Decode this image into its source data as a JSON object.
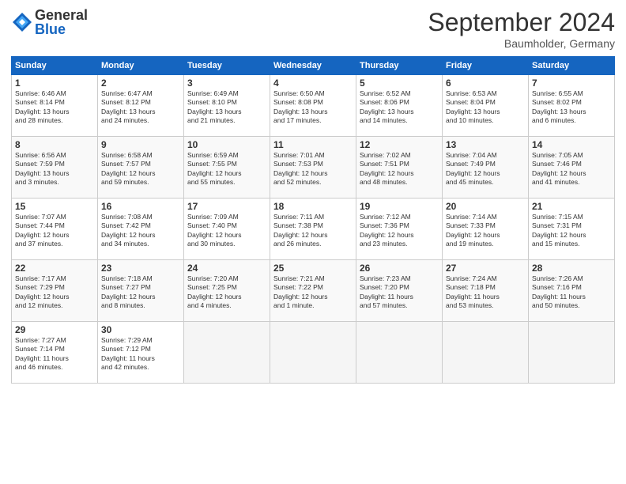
{
  "logo": {
    "general": "General",
    "blue": "Blue"
  },
  "title": "September 2024",
  "subtitle": "Baumholder, Germany",
  "headers": [
    "Sunday",
    "Monday",
    "Tuesday",
    "Wednesday",
    "Thursday",
    "Friday",
    "Saturday"
  ],
  "weeks": [
    [
      {
        "day": "1",
        "info": "Sunrise: 6:46 AM\nSunset: 8:14 PM\nDaylight: 13 hours\nand 28 minutes."
      },
      {
        "day": "2",
        "info": "Sunrise: 6:47 AM\nSunset: 8:12 PM\nDaylight: 13 hours\nand 24 minutes."
      },
      {
        "day": "3",
        "info": "Sunrise: 6:49 AM\nSunset: 8:10 PM\nDaylight: 13 hours\nand 21 minutes."
      },
      {
        "day": "4",
        "info": "Sunrise: 6:50 AM\nSunset: 8:08 PM\nDaylight: 13 hours\nand 17 minutes."
      },
      {
        "day": "5",
        "info": "Sunrise: 6:52 AM\nSunset: 8:06 PM\nDaylight: 13 hours\nand 14 minutes."
      },
      {
        "day": "6",
        "info": "Sunrise: 6:53 AM\nSunset: 8:04 PM\nDaylight: 13 hours\nand 10 minutes."
      },
      {
        "day": "7",
        "info": "Sunrise: 6:55 AM\nSunset: 8:02 PM\nDaylight: 13 hours\nand 6 minutes."
      }
    ],
    [
      {
        "day": "8",
        "info": "Sunrise: 6:56 AM\nSunset: 7:59 PM\nDaylight: 13 hours\nand 3 minutes."
      },
      {
        "day": "9",
        "info": "Sunrise: 6:58 AM\nSunset: 7:57 PM\nDaylight: 12 hours\nand 59 minutes."
      },
      {
        "day": "10",
        "info": "Sunrise: 6:59 AM\nSunset: 7:55 PM\nDaylight: 12 hours\nand 55 minutes."
      },
      {
        "day": "11",
        "info": "Sunrise: 7:01 AM\nSunset: 7:53 PM\nDaylight: 12 hours\nand 52 minutes."
      },
      {
        "day": "12",
        "info": "Sunrise: 7:02 AM\nSunset: 7:51 PM\nDaylight: 12 hours\nand 48 minutes."
      },
      {
        "day": "13",
        "info": "Sunrise: 7:04 AM\nSunset: 7:49 PM\nDaylight: 12 hours\nand 45 minutes."
      },
      {
        "day": "14",
        "info": "Sunrise: 7:05 AM\nSunset: 7:46 PM\nDaylight: 12 hours\nand 41 minutes."
      }
    ],
    [
      {
        "day": "15",
        "info": "Sunrise: 7:07 AM\nSunset: 7:44 PM\nDaylight: 12 hours\nand 37 minutes."
      },
      {
        "day": "16",
        "info": "Sunrise: 7:08 AM\nSunset: 7:42 PM\nDaylight: 12 hours\nand 34 minutes."
      },
      {
        "day": "17",
        "info": "Sunrise: 7:09 AM\nSunset: 7:40 PM\nDaylight: 12 hours\nand 30 minutes."
      },
      {
        "day": "18",
        "info": "Sunrise: 7:11 AM\nSunset: 7:38 PM\nDaylight: 12 hours\nand 26 minutes."
      },
      {
        "day": "19",
        "info": "Sunrise: 7:12 AM\nSunset: 7:36 PM\nDaylight: 12 hours\nand 23 minutes."
      },
      {
        "day": "20",
        "info": "Sunrise: 7:14 AM\nSunset: 7:33 PM\nDaylight: 12 hours\nand 19 minutes."
      },
      {
        "day": "21",
        "info": "Sunrise: 7:15 AM\nSunset: 7:31 PM\nDaylight: 12 hours\nand 15 minutes."
      }
    ],
    [
      {
        "day": "22",
        "info": "Sunrise: 7:17 AM\nSunset: 7:29 PM\nDaylight: 12 hours\nand 12 minutes."
      },
      {
        "day": "23",
        "info": "Sunrise: 7:18 AM\nSunset: 7:27 PM\nDaylight: 12 hours\nand 8 minutes."
      },
      {
        "day": "24",
        "info": "Sunrise: 7:20 AM\nSunset: 7:25 PM\nDaylight: 12 hours\nand 4 minutes."
      },
      {
        "day": "25",
        "info": "Sunrise: 7:21 AM\nSunset: 7:22 PM\nDaylight: 12 hours\nand 1 minute."
      },
      {
        "day": "26",
        "info": "Sunrise: 7:23 AM\nSunset: 7:20 PM\nDaylight: 11 hours\nand 57 minutes."
      },
      {
        "day": "27",
        "info": "Sunrise: 7:24 AM\nSunset: 7:18 PM\nDaylight: 11 hours\nand 53 minutes."
      },
      {
        "day": "28",
        "info": "Sunrise: 7:26 AM\nSunset: 7:16 PM\nDaylight: 11 hours\nand 50 minutes."
      }
    ],
    [
      {
        "day": "29",
        "info": "Sunrise: 7:27 AM\nSunset: 7:14 PM\nDaylight: 11 hours\nand 46 minutes."
      },
      {
        "day": "30",
        "info": "Sunrise: 7:29 AM\nSunset: 7:12 PM\nDaylight: 11 hours\nand 42 minutes."
      },
      {
        "day": "",
        "info": ""
      },
      {
        "day": "",
        "info": ""
      },
      {
        "day": "",
        "info": ""
      },
      {
        "day": "",
        "info": ""
      },
      {
        "day": "",
        "info": ""
      }
    ]
  ]
}
